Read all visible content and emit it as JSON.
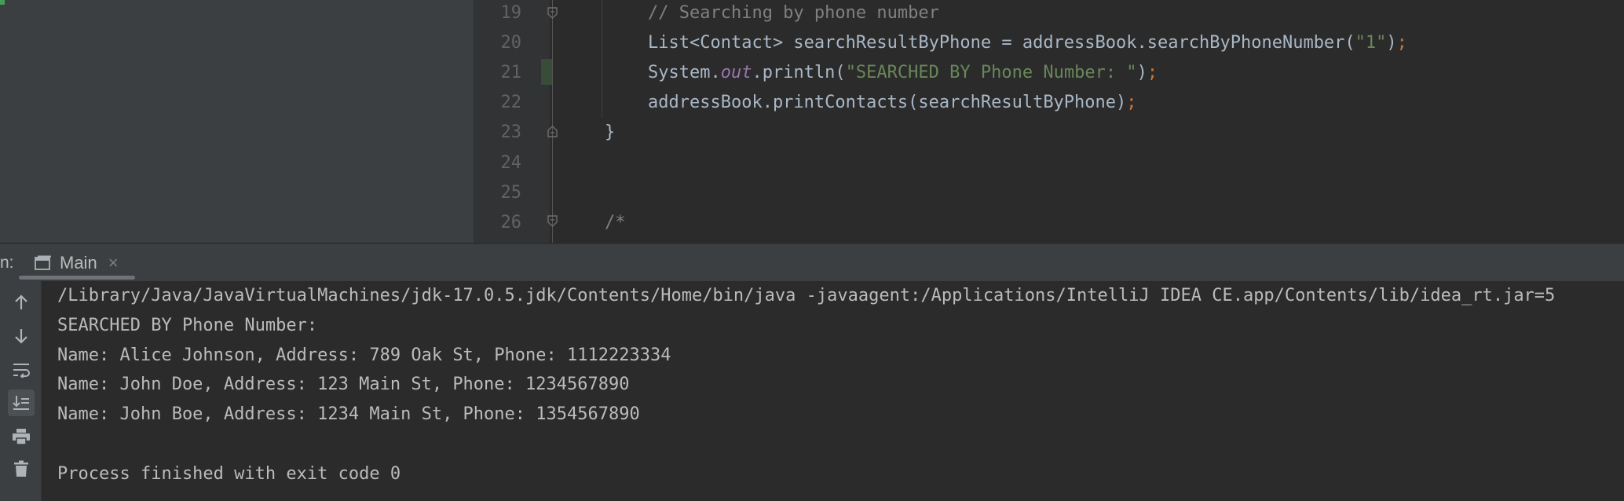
{
  "editor": {
    "lines": [
      {
        "num": "19",
        "parts": [
          [
            "cm",
            "// Searching by phone number"
          ]
        ]
      },
      {
        "num": "20",
        "parts": [
          [
            "txt",
            "List<Contact> searchResultByPhone = addressBook.searchByPhoneNumber("
          ],
          [
            "str",
            "\"1\""
          ],
          [
            "txt",
            ")"
          ],
          [
            "semi",
            ";"
          ]
        ]
      },
      {
        "num": "21",
        "parts": [
          [
            "txt",
            "System."
          ],
          [
            "field",
            "out"
          ],
          [
            "txt",
            ".println("
          ],
          [
            "str",
            "\"SEARCHED BY Phone Number: \""
          ],
          [
            "txt",
            ")"
          ],
          [
            "semi",
            ";"
          ]
        ]
      },
      {
        "num": "22",
        "parts": [
          [
            "txt",
            "addressBook.printContacts(searchResultByPhone)"
          ],
          [
            "semi",
            ";"
          ]
        ]
      },
      {
        "num": "23",
        "parts": [
          [
            "txt",
            "}"
          ]
        ]
      },
      {
        "num": "24",
        "parts": []
      },
      {
        "num": "25",
        "parts": []
      },
      {
        "num": "26",
        "parts": [
          [
            "cm",
            "/*"
          ]
        ]
      }
    ]
  },
  "run": {
    "label": "n:",
    "tab_label": "Main",
    "close_glyph": "×",
    "toolbar_icons": [
      "arrow-up-icon",
      "arrow-down-icon",
      "soft-wrap-icon",
      "scroll-to-end-icon",
      "print-icon",
      "trash-icon"
    ]
  },
  "console": {
    "lines": [
      "/Library/Java/JavaVirtualMachines/jdk-17.0.5.jdk/Contents/Home/bin/java -javaagent:/Applications/IntelliJ IDEA CE.app/Contents/lib/idea_rt.jar=5",
      "SEARCHED BY Phone Number:",
      "Name: Alice Johnson, Address: 789 Oak St, Phone: 1112223334",
      "Name: John Doe, Address: 123 Main St, Phone: 1234567890",
      "Name: John Boe, Address: 1234 Main St, Phone: 1354567890",
      "",
      "Process finished with exit code 0"
    ]
  }
}
